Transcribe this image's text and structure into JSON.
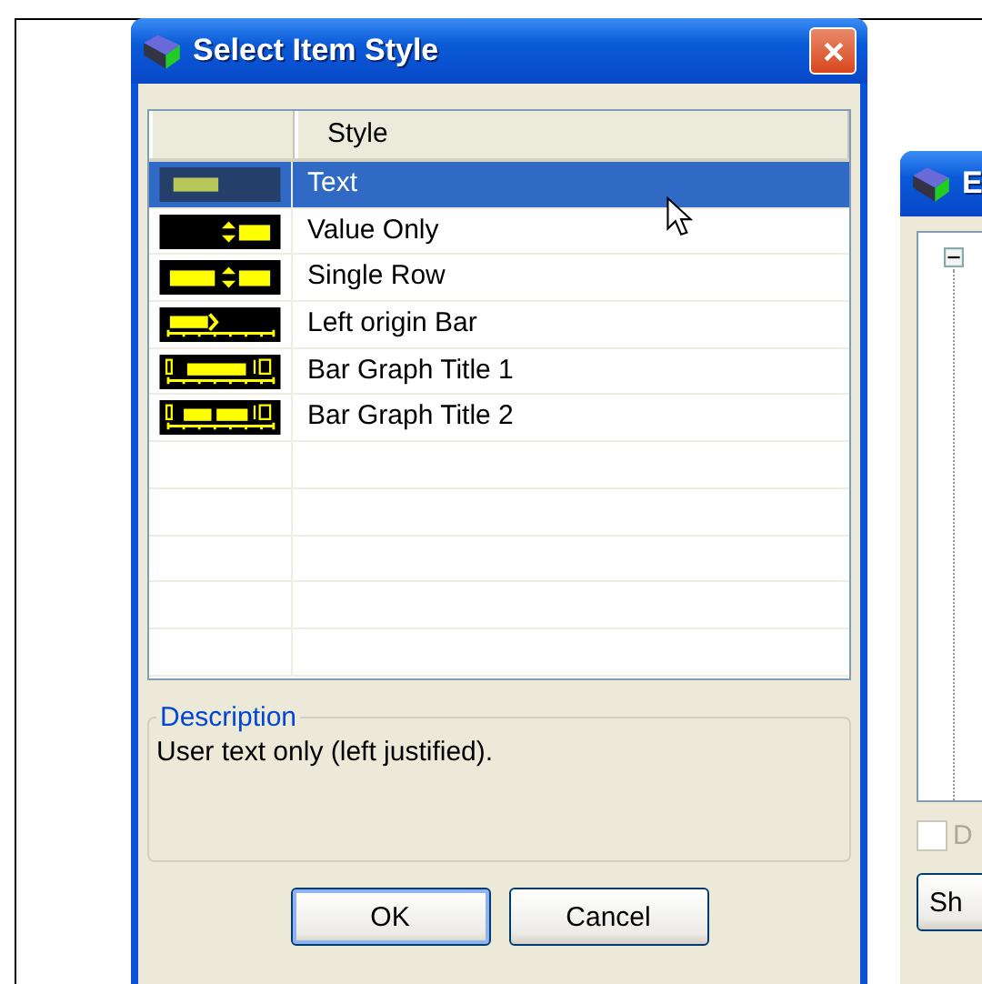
{
  "dialog": {
    "title": "Select Item Style",
    "list": {
      "columns": [
        "Style"
      ],
      "rows": [
        {
          "kind": "text",
          "label": "Text",
          "selected": true
        },
        {
          "kind": "value",
          "label": "Value Only",
          "selected": false
        },
        {
          "kind": "single",
          "label": "Single Row",
          "selected": false
        },
        {
          "kind": "leftbar",
          "label": "Left origin Bar",
          "selected": false
        },
        {
          "kind": "graph1",
          "label": "Bar Graph Title 1",
          "selected": false
        },
        {
          "kind": "graph2",
          "label": "Bar Graph Title 2",
          "selected": false
        }
      ]
    },
    "description": {
      "legend": "Description",
      "text": "User text only (left justified)."
    },
    "buttons": [
      {
        "label": "OK",
        "default": true
      },
      {
        "label": "Cancel",
        "default": false
      }
    ]
  },
  "background_window": {
    "title": "E",
    "checkbox": {
      "label": "D",
      "checked": false
    },
    "button": "Sh"
  }
}
